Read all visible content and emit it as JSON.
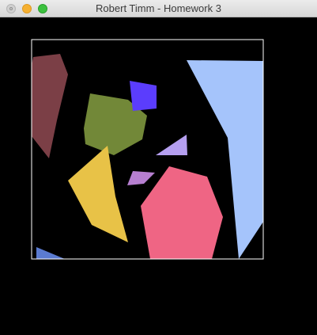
{
  "window": {
    "title": "Robert Timm - Homework 3"
  },
  "icons": {
    "close": "close-button",
    "minimize": "minimize-button",
    "zoom": "zoom-button"
  },
  "colors": {
    "background": "#000000",
    "frame": "#ffffff",
    "maroon_polygon": "#7b3f46",
    "olive_polygon": "#728838",
    "blue_square": "#5b3dfd",
    "light_blue_polygon": "#a5c4fb",
    "lavender_triangle": "#b59ff0",
    "purple_quad": "#b67fd0",
    "yellow_polygon": "#e8c247",
    "pink_hexagon": "#ef6584",
    "steel_blue_sliver": "#5b7bd0"
  }
}
